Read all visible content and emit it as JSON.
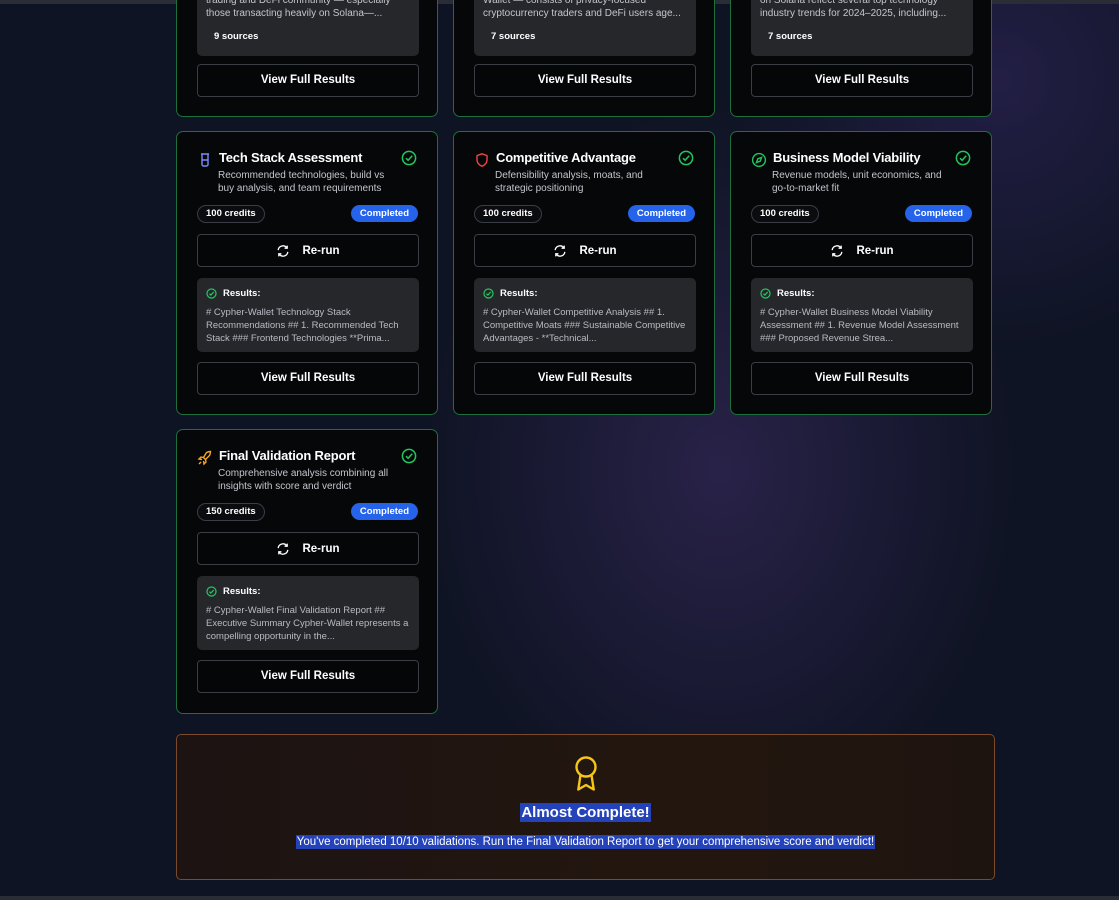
{
  "top_cards": [
    {
      "snippet": "trading and DeFi community — especially those transacting heavily on Solana—...",
      "sources": "9 sources",
      "view_label": "View Full Results"
    },
    {
      "snippet": "Wallet — consists of privacy-focused cryptocurrency traders and DeFi users age...",
      "sources": "7 sources",
      "view_label": "View Full Results"
    },
    {
      "snippet": "on Solana reflect several top technology industry trends for 2024–2025, including...",
      "sources": "7 sources",
      "view_label": "View Full Results"
    }
  ],
  "cards": [
    {
      "title": "Tech Stack Assessment",
      "icon": "beaker-icon",
      "icon_color": "#7b8cff",
      "description": "Recommended technologies, build vs buy analysis, and team requirements",
      "credits": "100 credits",
      "status": "Completed",
      "rerun_label": "Re-run",
      "results_label": "Results:",
      "results_text": "# Cypher-Wallet Technology Stack Recommendations ## 1. Recommended Tech Stack ### Frontend Technologies **Prima...",
      "view_label": "View Full Results"
    },
    {
      "title": "Competitive Advantage",
      "icon": "shield-icon",
      "icon_color": "#ef4444",
      "description": "Defensibility analysis, moats, and strategic positioning",
      "credits": "100 credits",
      "status": "Completed",
      "rerun_label": "Re-run",
      "results_label": "Results:",
      "results_text": "# Cypher-Wallet Competitive Analysis ## 1. Competitive Moats ### Sustainable Competitive Advantages - **Technical...",
      "view_label": "View Full Results"
    },
    {
      "title": "Business Model Viability",
      "icon": "compass-icon",
      "icon_color": "#22c55e",
      "description": "Revenue models, unit economics, and go-to-market fit",
      "credits": "100 credits",
      "status": "Completed",
      "rerun_label": "Re-run",
      "results_label": "Results:",
      "results_text": "# Cypher-Wallet Business Model Viability Assessment ## 1. Revenue Model Assessment ### Proposed Revenue Strea...",
      "view_label": "View Full Results"
    },
    {
      "title": "Final Validation Report",
      "icon": "rocket-icon",
      "icon_color": "#f5a623",
      "description": "Comprehensive analysis combining all insights with score and verdict",
      "credits": "150 credits",
      "status": "Completed",
      "rerun_label": "Re-run",
      "results_label": "Results:",
      "results_text": "# Cypher-Wallet Final Validation Report ## Executive Summary Cypher-Wallet represents a compelling opportunity in the...",
      "view_label": "View Full Results"
    }
  ],
  "banner": {
    "icon": "award-icon",
    "title": "Almost Complete!",
    "subtitle": "You've completed 10/10 validations. Run the Final Validation Report to get your comprehensive score and verdict!"
  },
  "colors": {
    "accent_green": "#22c55e",
    "status_blue": "#2563eb",
    "award_gold": "#f5c518"
  }
}
